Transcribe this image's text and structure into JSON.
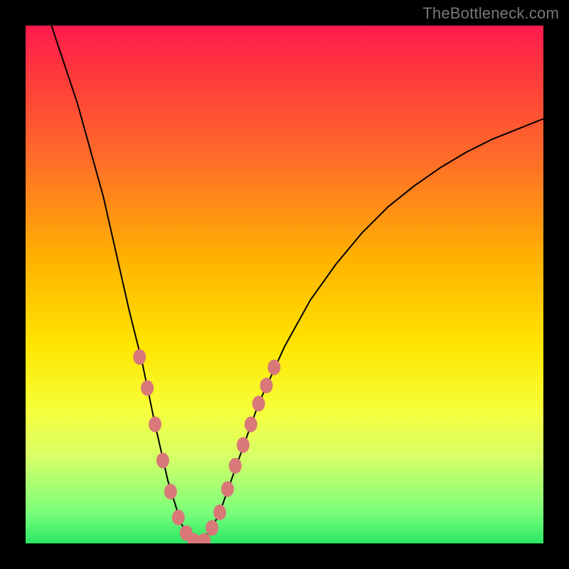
{
  "watermark": "TheBottleneck.com",
  "chart_data": {
    "type": "line",
    "title": "",
    "xlabel": "",
    "ylabel": "",
    "xlim": [
      0,
      100
    ],
    "ylim": [
      0,
      100
    ],
    "series": [
      {
        "name": "bottleneck-curve",
        "x": [
          5,
          10,
          15,
          20,
          22.5,
          25,
          27.5,
          30,
          31,
          32,
          33,
          34,
          35,
          36,
          37.5,
          40,
          42.5,
          45,
          50,
          55,
          60,
          65,
          70,
          75,
          80,
          85,
          90,
          95,
          100
        ],
        "values": [
          100,
          85,
          67,
          45,
          35,
          23,
          12,
          4,
          2,
          1,
          0,
          0.5,
          1.5,
          3,
          6,
          13,
          20,
          27,
          38,
          47,
          54,
          60,
          65,
          69,
          72.5,
          75.5,
          78,
          80,
          82
        ]
      }
    ],
    "markers": {
      "name": "highlighted-points",
      "color": "#d87878",
      "points": [
        {
          "x": 22,
          "y": 36
        },
        {
          "x": 23.5,
          "y": 30
        },
        {
          "x": 25,
          "y": 23
        },
        {
          "x": 26.5,
          "y": 16
        },
        {
          "x": 28,
          "y": 10
        },
        {
          "x": 29.5,
          "y": 5
        },
        {
          "x": 31,
          "y": 2
        },
        {
          "x": 32.5,
          "y": 0.5
        },
        {
          "x": 33.5,
          "y": 0
        },
        {
          "x": 34.5,
          "y": 0.5
        },
        {
          "x": 36,
          "y": 3
        },
        {
          "x": 37.5,
          "y": 6
        },
        {
          "x": 39,
          "y": 10.5
        },
        {
          "x": 40.5,
          "y": 15
        },
        {
          "x": 42,
          "y": 19
        },
        {
          "x": 43.5,
          "y": 23
        },
        {
          "x": 45,
          "y": 27
        },
        {
          "x": 46.5,
          "y": 30.5
        },
        {
          "x": 48,
          "y": 34
        }
      ]
    }
  }
}
